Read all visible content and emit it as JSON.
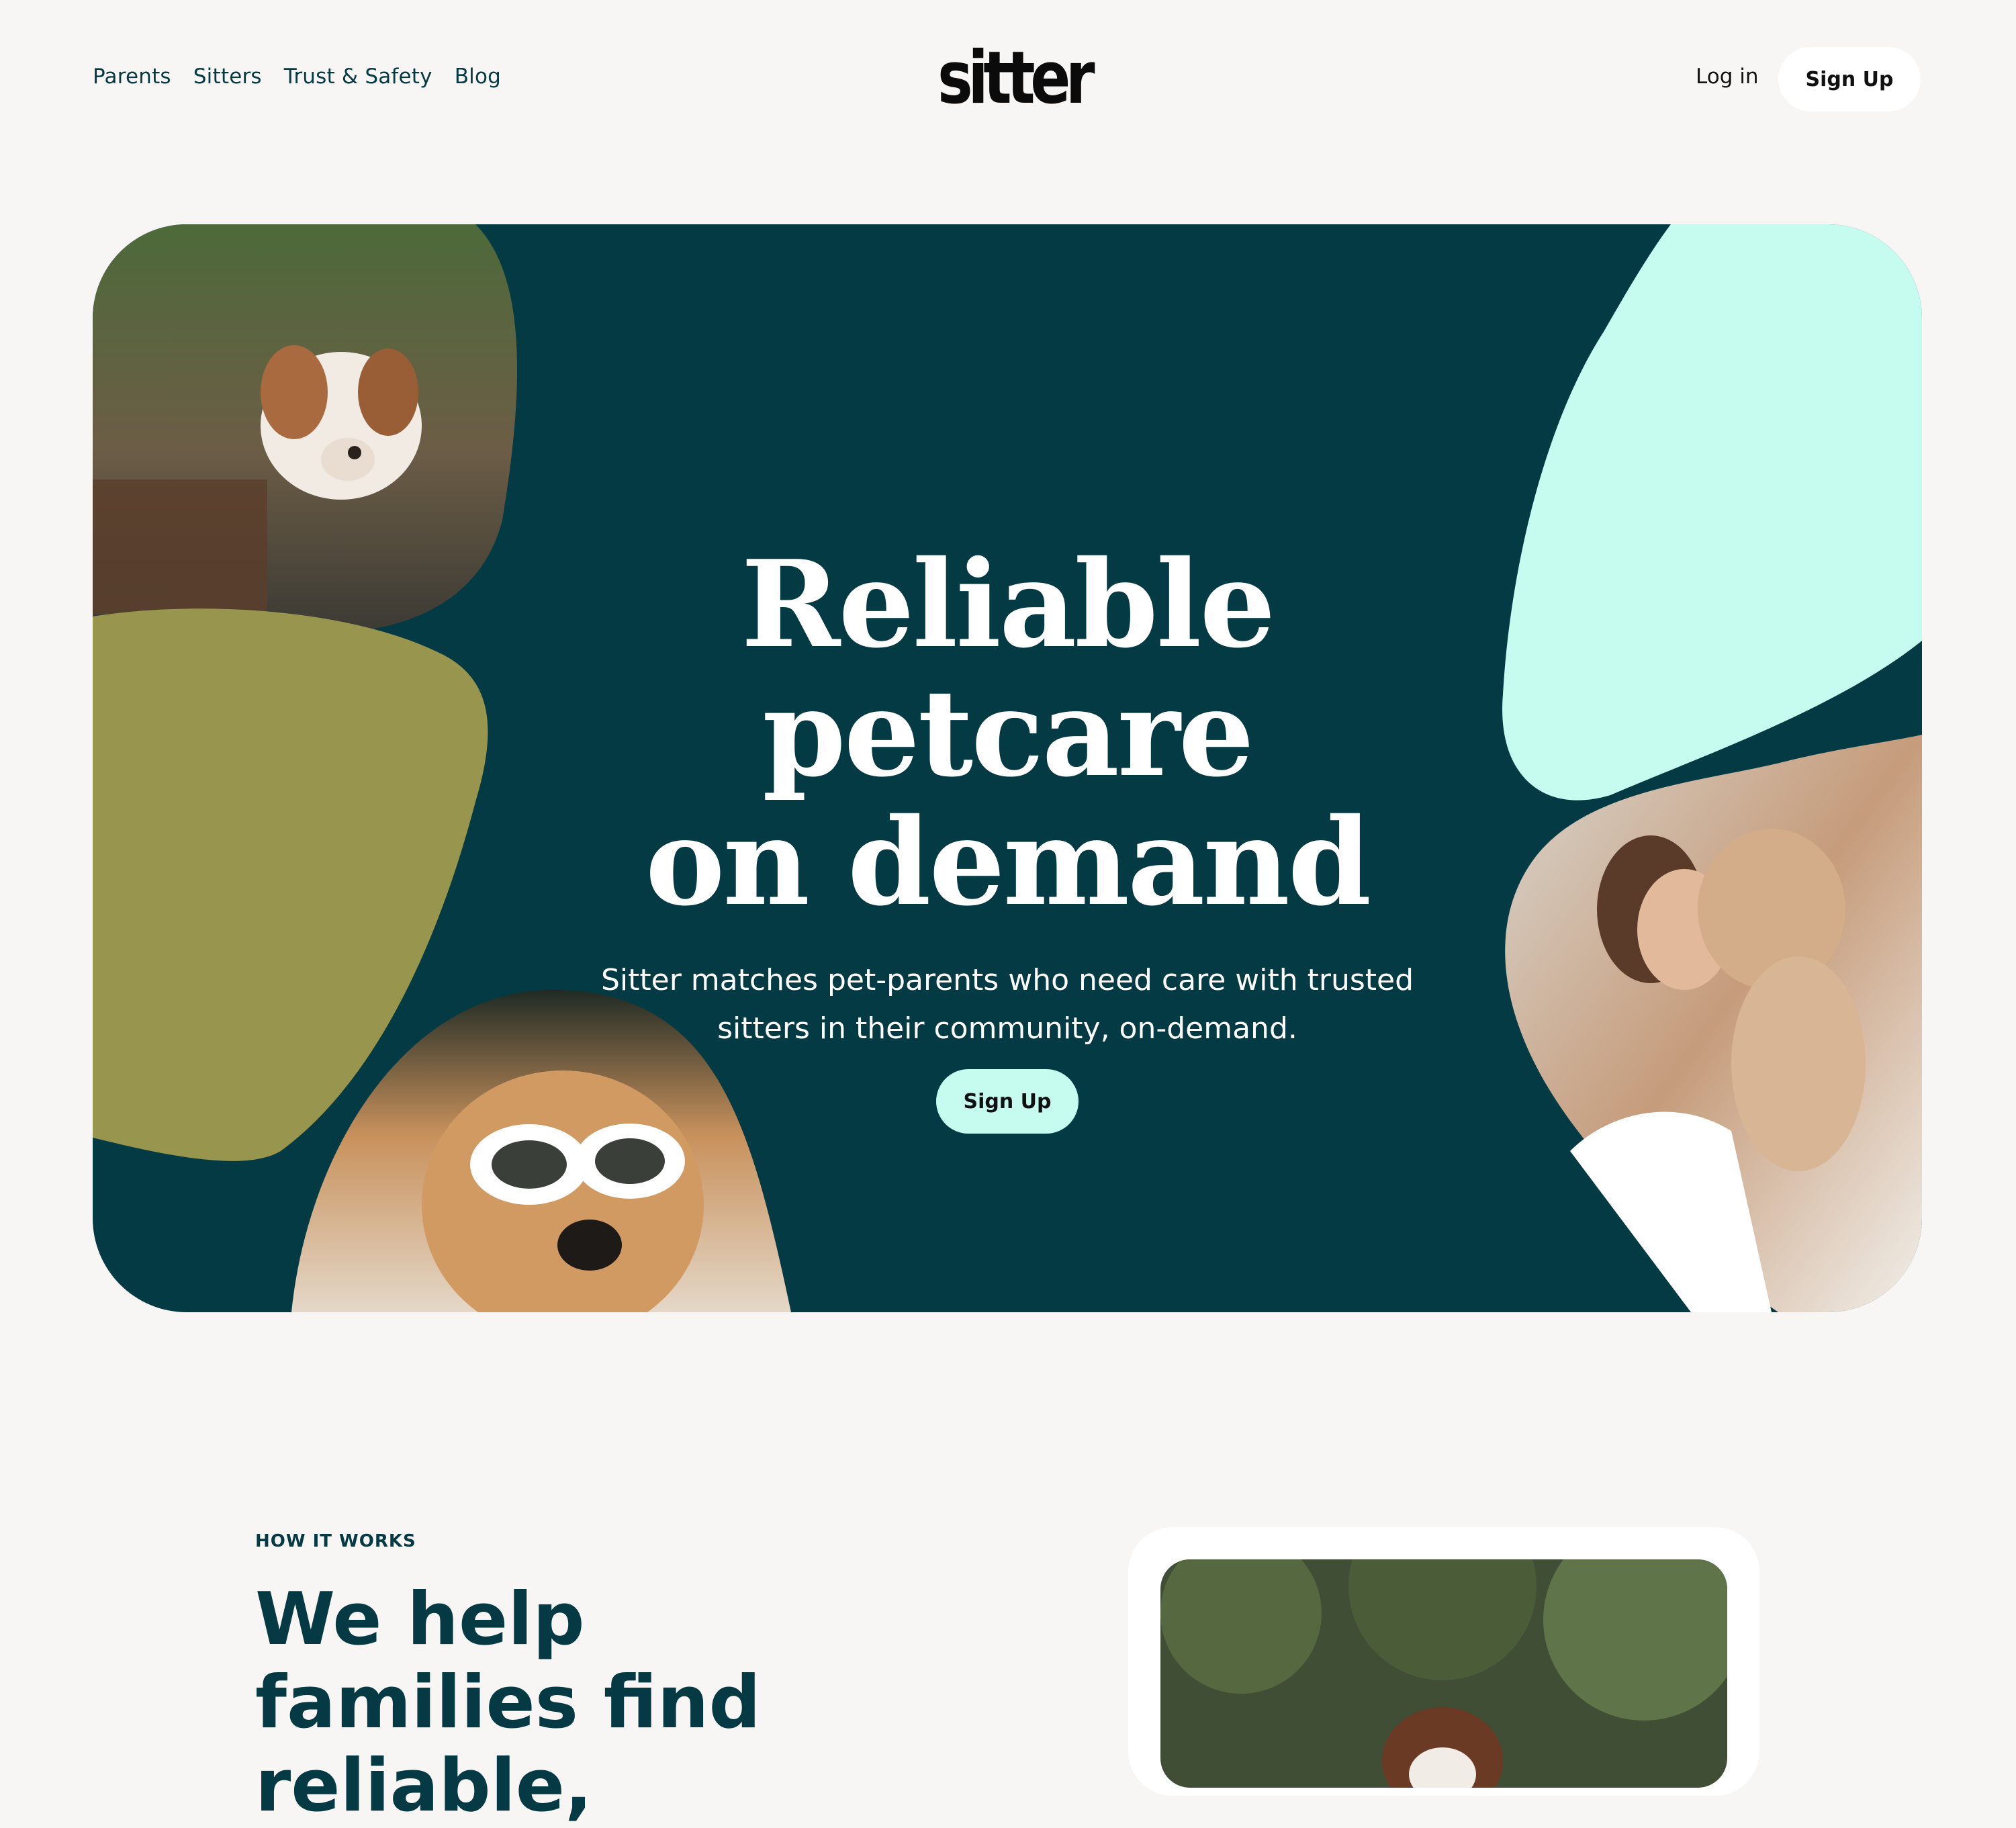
{
  "header": {
    "nav": [
      "Parents",
      "Sitters",
      "Trust & Safety",
      "Blog"
    ],
    "logo": "sitter",
    "login_label": "Log in",
    "signup_label": "Sign Up"
  },
  "hero": {
    "title_line1": "Reliable petcare",
    "title_line2": "on demand",
    "subtitle": "Sitter matches pet-parents who need care with trusted sitters in their community, on-demand.",
    "cta_label": "Sign Up"
  },
  "how_it_works": {
    "label": "HOW IT WORKS",
    "title": "We help families find reliable,"
  },
  "colors": {
    "background": "#f8f6f4",
    "hero_bg": "#033a44",
    "mint": "#c6fbef",
    "olive": "#97954e",
    "text_dark": "#053a44"
  }
}
